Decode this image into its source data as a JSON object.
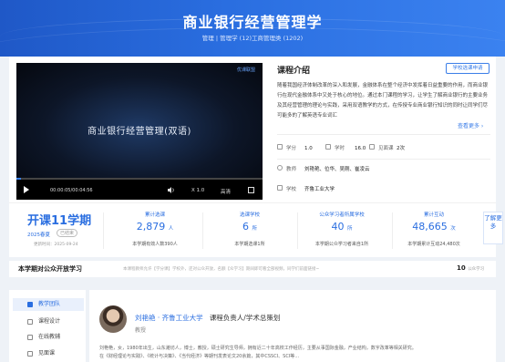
{
  "banner": {
    "title": "商业银行经营管理学",
    "subtitle": "管理 | 管理学 (12)工商管理类 (1202)"
  },
  "video": {
    "title": "商业银行经营管理(双语)",
    "logo": "优课联盟",
    "current_time": "00:00:05",
    "total_time": "00:04:56",
    "time_display": "00:00:05/00:04:56",
    "progress": 0.02,
    "speed": "X 1.0",
    "quality": "高清"
  },
  "intro": {
    "title": "课程介绍",
    "apply_button": "学校选课申请",
    "text": "随着我国经济体制改革的深入和发展，金融体系在整个经济中发挥着日益重要的作用，而商业银行在现代金融体系中又处于核心的地位。通过本门课程的学习，让学生了解商业银行的主要业务及其经营管理的理论与实践，采用双语教学的方式，在传授专业商业银行知识的同时让同学们尽可能多的了解英语专业词汇",
    "more_link": "查看更多 ›",
    "credit_label": "学分",
    "credit_value": "1.0",
    "hours_label": "学时",
    "hours_value": "16.0",
    "meeting_label": "见面课",
    "meeting_value": "2次",
    "teachers_label": "教师",
    "teachers_value": "刘艳艳、位华、吴刚、崔凌云",
    "school_label": "学校",
    "school_value": "齐鲁工业大学"
  },
  "term": {
    "title": "开课11学期",
    "season": "2025春夏",
    "status": "已结束",
    "updated": "更新时间：2025-09-24"
  },
  "stats": [
    {
      "label": "累计选课",
      "value": "2,879",
      "unit": "人",
      "foot": "本学期有效人数390人"
    },
    {
      "label": "选课学校",
      "value": "6",
      "unit": "所",
      "foot": "本学期选课1所"
    },
    {
      "label": "公众学习者所属学校",
      "value": "40",
      "unit": "所",
      "foot": "本学期公众学习者来自1所"
    },
    {
      "label": "累计互动",
      "value": "48,665",
      "unit": "次",
      "foot": "本学期累计互动24,480次"
    }
  ],
  "side_tab": "了解更多",
  "share": {
    "title": "本学期对公众开放学习",
    "note": "本课程教师允许【学分课】学校外，还对公众开放，名额【众学习】期间即可看全部视频，同学们前面链接~",
    "count": "10",
    "count_unit": "公众学习"
  },
  "nav": [
    {
      "label": "教学团队",
      "icon": "team-icon"
    },
    {
      "label": "课程设计",
      "icon": "design-icon"
    },
    {
      "label": "在线教辅",
      "icon": "book-icon"
    },
    {
      "label": "见面课",
      "icon": "meeting-icon"
    }
  ],
  "teacher": {
    "name": "刘艳艳 · 齐鲁工业大学",
    "role": "课程负责人/学术总策划",
    "title": "教授",
    "bio": "刘艳艳，女，1980年出生，山东潍坊人，博士，教授，硕士研究生导师，拥有近二十年高校工作经历，主要从事国际金融，产业结构，数字改革等相关研究。",
    "bio2": "在《财经理论与实践》、《统计与决策》、《当代经济》等期刊发表论文20余篇，其中CSSCI、SCI等..."
  },
  "colors": {
    "accent": "#2a6ee0",
    "banner": "#2a6ee0"
  }
}
